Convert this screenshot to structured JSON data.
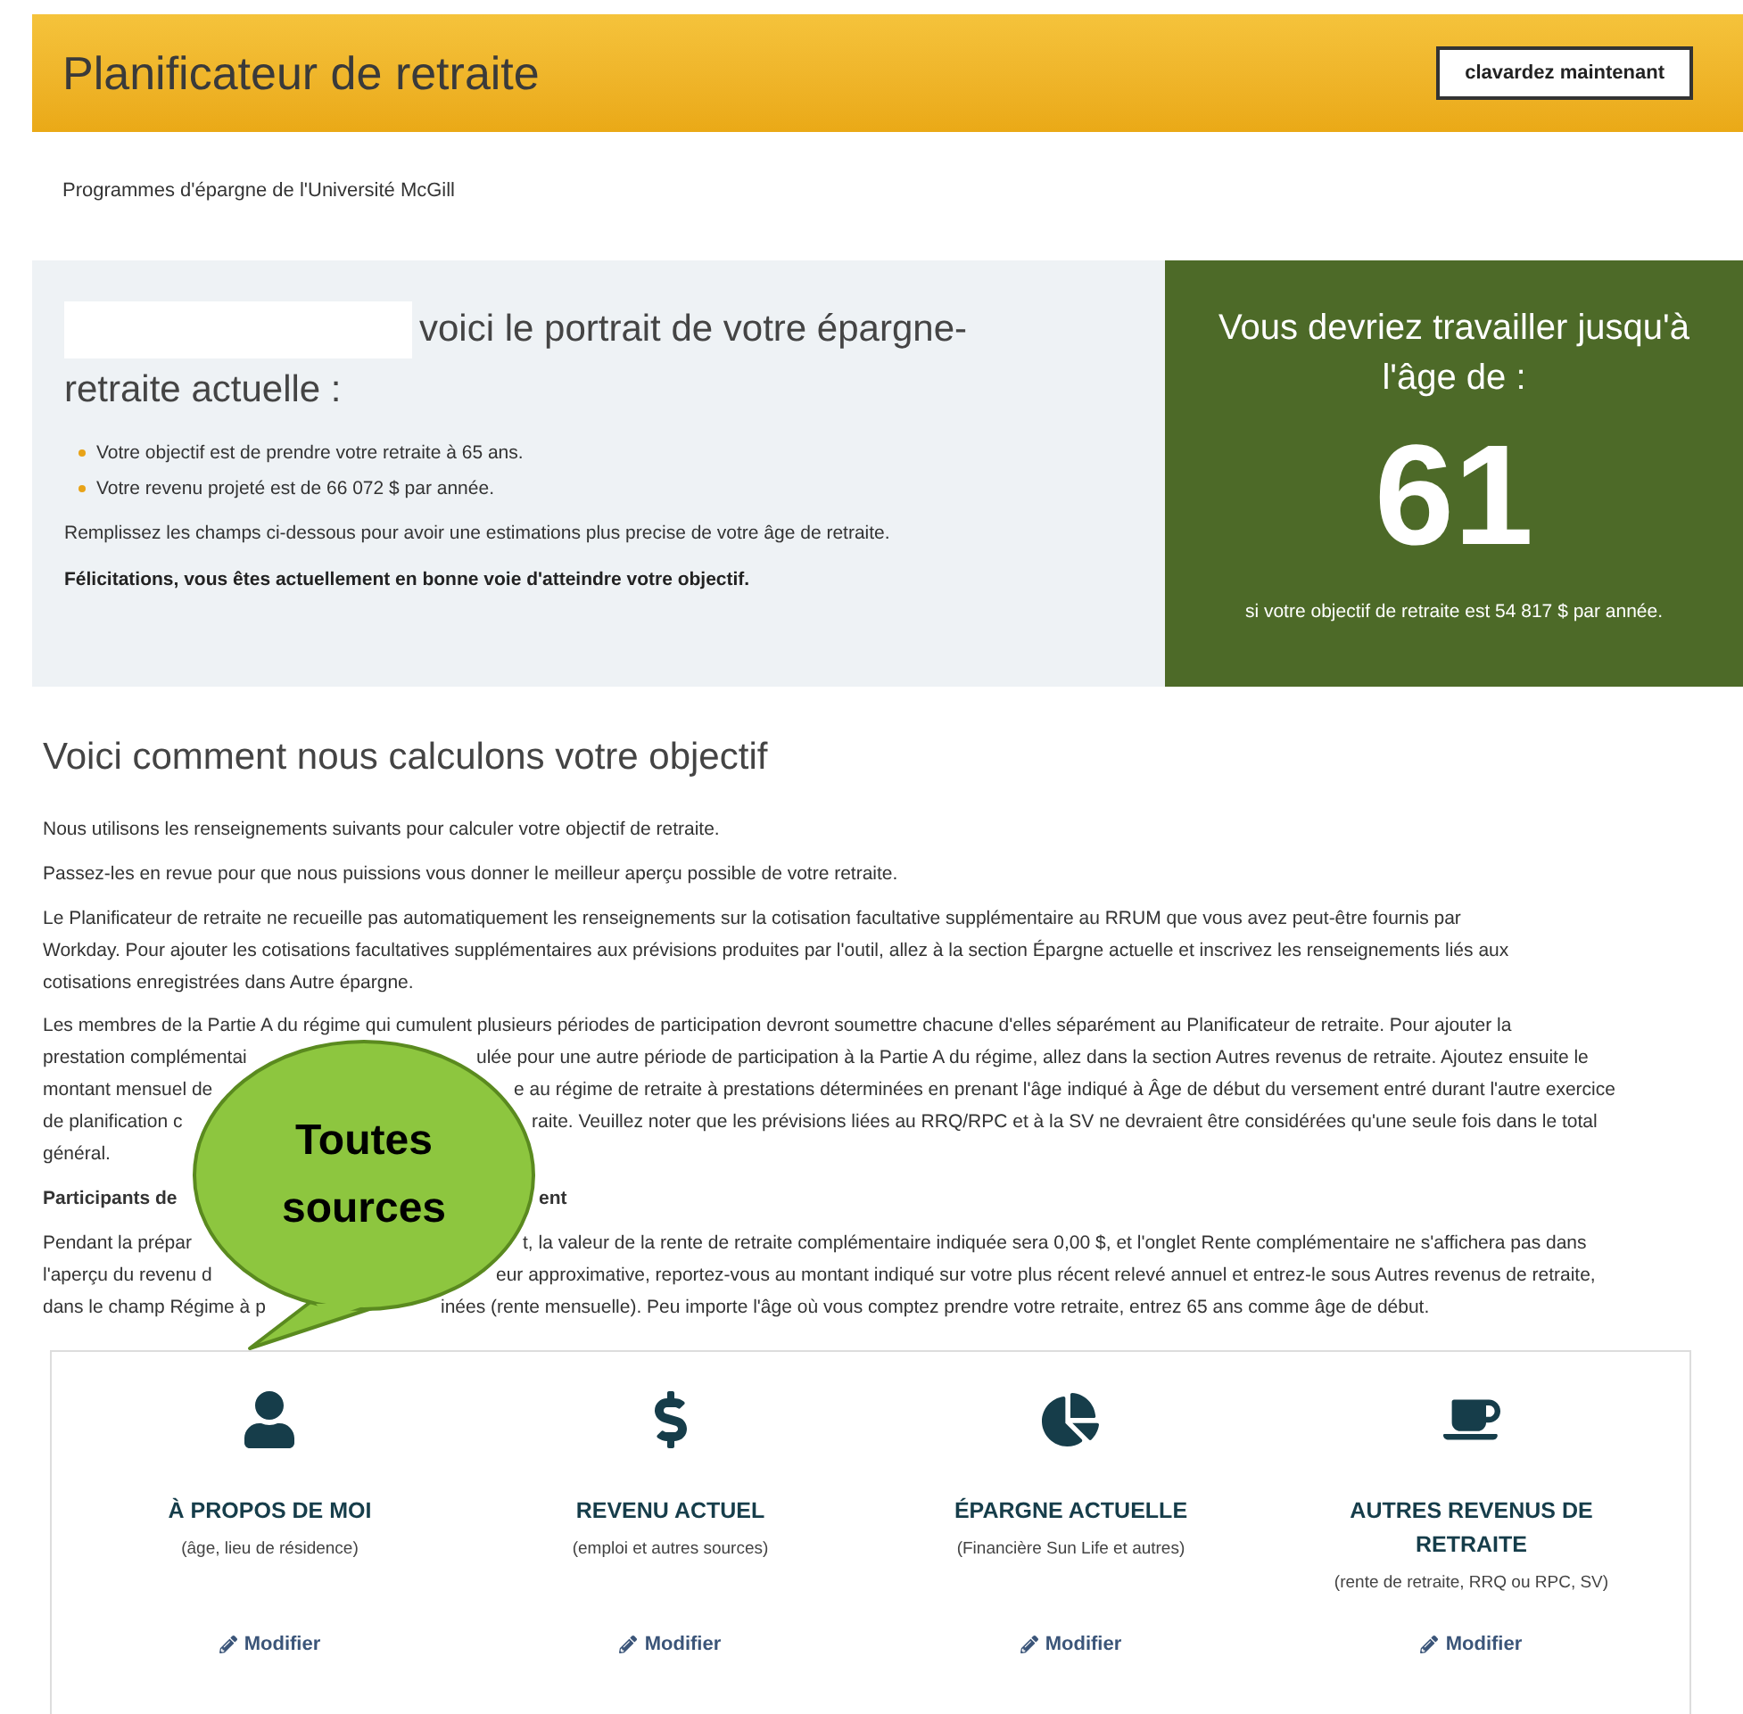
{
  "header": {
    "title": "Planificateur de retraite",
    "chat_button": "clavardez maintenant"
  },
  "subtitle": "Programmes d'épargne de l'Université McGill",
  "summary": {
    "heading_lines": [
      "voici le portrait de votre épargne-",
      "retraite actuelle :"
    ],
    "bullets": [
      "Votre objectif est de prendre votre retraite à 65 ans.",
      "Votre revenu projeté est de 66 072 $ par année."
    ],
    "note": "Remplissez les champs ci-dessous pour avoir une estimations plus precise de votre âge de retraite.",
    "congrats": "Félicitations, vous êtes actuellement en bonne voie d'atteindre votre objectif."
  },
  "result": {
    "label": "Vous devriez travailler jusqu'à l'âge de :",
    "age": "61",
    "condition": "si votre objectif de retraite est 54 817 $ par année."
  },
  "section": {
    "title": "Voici comment nous calculons votre objectif",
    "paragraphs": [
      {
        "kind": "plain",
        "text": "Nous utilisons les renseignements suivants pour calculer votre objectif de retraite."
      },
      {
        "kind": "plain",
        "text": "Passez-les en revue pour que nous puissions vous donner le meilleur aperçu possible de votre retraite."
      },
      {
        "kind": "plain",
        "text": "Le Planificateur de retraite ne recueille pas automatiquement les renseignements sur la cotisation facultative supplémentaire au RRUM que vous avez peut-être fournis par Workday. Pour ajouter les cotisations facultatives supplémentaires aux prévisions produites par l'outil, allez à la section Épargne actuelle et inscrivez les renseignements liés aux cotisations enregistrées dans Autre épargne."
      },
      {
        "kind": "covered",
        "lines": [
          [
            "Les membres de la Partie A du régime qui cumulent plusieurs périodes de participation devront soumettre chacune d'elles séparément au Planificateur de retraite. Pour ajouter la"
          ],
          [
            "prestation complémentai",
            "ulée pour une autre période de participation à la Partie A du régime, allez dans la section Autres revenus de retraite. Ajoutez ensuite le"
          ],
          [
            "montant mensuel de",
            "e au régime de retraite à prestations déterminées en prenant l'âge indiqué à Âge de début du versement entré durant l'autre exercice"
          ],
          [
            "de planification c",
            "raite. Veuillez noter que les prévisions liées au RRQ/RPC et à la SV ne devraient être considérées qu'une seule fois dans le total"
          ],
          [
            "général."
          ]
        ]
      },
      {
        "kind": "heading",
        "lines": [
          [
            "Participants de",
            "ent"
          ]
        ]
      },
      {
        "kind": "covered",
        "lines": [
          [
            "Pendant la prépar",
            "t, la valeur de la rente de retraite complémentaire indiquée sera 0,00 $, et l'onglet Rente complémentaire ne s'affichera pas dans"
          ],
          [
            "l'aperçu du revenu d",
            "eur approximative, reportez-vous au montant indiqué sur votre plus récent relevé annuel et entrez-le sous Autres revenus de retraite,"
          ],
          [
            "dans le champ Régime à p",
            "inées (rente mensuelle). Peu importe l'âge où vous comptez prendre votre retraite, entrez 65 ans comme âge de début."
          ]
        ]
      }
    ]
  },
  "callout": "Toutes sources",
  "cards": [
    {
      "kind": "person",
      "title": "À PROPOS DE MOI",
      "subtitle": "(âge, lieu de résidence)",
      "link": "Modifier"
    },
    {
      "kind": "dollar",
      "title": "REVENU ACTUEL",
      "subtitle": "(emploi et autres sources)",
      "link": "Modifier"
    },
    {
      "kind": "pie",
      "title": "ÉPARGNE ACTUELLE",
      "subtitle": "(Financière Sun Life et autres)",
      "link": "Modifier"
    },
    {
      "kind": "cup",
      "title": "AUTRES REVENUS DE RETRAITE",
      "subtitle": "(rente de retraite, RRQ ou RPC, SV)",
      "link": "Modifier"
    }
  ]
}
